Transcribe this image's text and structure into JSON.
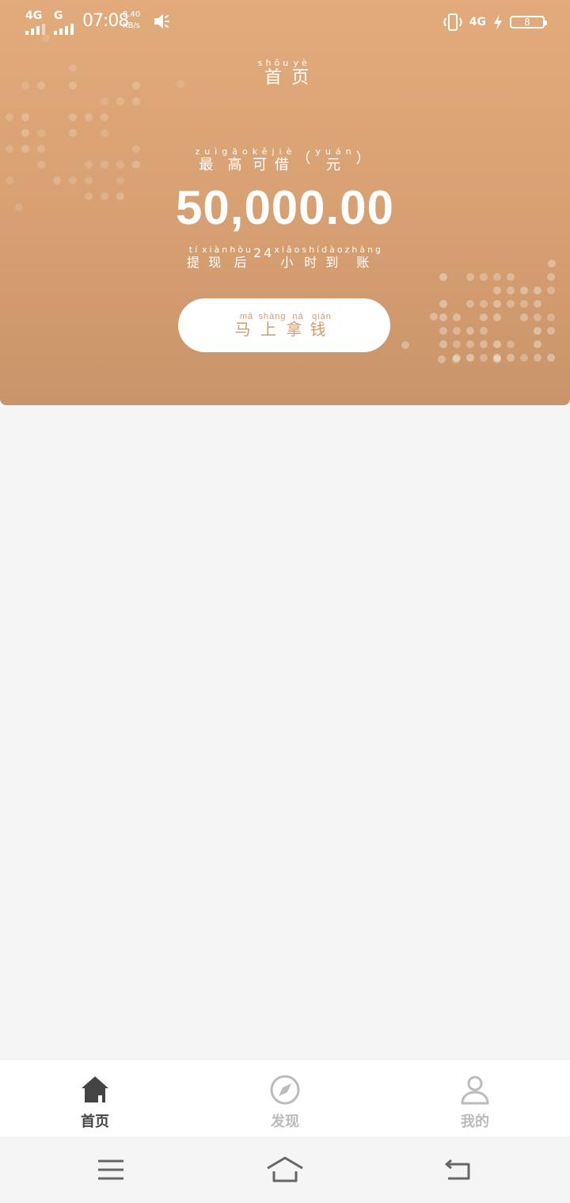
{
  "status_bar": {
    "network1": "4G",
    "network2": "G",
    "time": "07:08",
    "speed_value": "8.40",
    "speed_unit": "KB/s",
    "network3": "4G",
    "battery_level": "8"
  },
  "header": {
    "title": [
      {
        "char": "首",
        "pinyin": "shǒu"
      },
      {
        "char": "页",
        "pinyin": "yè"
      }
    ]
  },
  "loan": {
    "limit_label": [
      {
        "char": "最",
        "pinyin": "zuì"
      },
      {
        "char": "高",
        "pinyin": "gāo"
      },
      {
        "char": "可",
        "pinyin": "kě"
      },
      {
        "char": "借",
        "pinyin": "jiè"
      },
      {
        "char": "（",
        "pinyin": ""
      },
      {
        "char": "元",
        "pinyin": "yuán"
      },
      {
        "char": "）",
        "pinyin": ""
      }
    ],
    "amount": "50,000.00",
    "note": [
      {
        "char": "提",
        "pinyin": "tí"
      },
      {
        "char": "现",
        "pinyin": "xiàn"
      },
      {
        "char": "后",
        "pinyin": "hòu"
      },
      {
        "char": "24",
        "pinyin": ""
      },
      {
        "char": "小",
        "pinyin": "xiǎo"
      },
      {
        "char": "时",
        "pinyin": "shí"
      },
      {
        "char": "到",
        "pinyin": "dào"
      },
      {
        "char": "账",
        "pinyin": "zhàng"
      }
    ],
    "cta": [
      {
        "char": "马",
        "pinyin": "mǎ"
      },
      {
        "char": "上",
        "pinyin": "shàng"
      },
      {
        "char": "拿",
        "pinyin": "ná"
      },
      {
        "char": "钱",
        "pinyin": "qián"
      }
    ]
  },
  "tabs": [
    {
      "label": "首页",
      "icon": "home-icon",
      "active": true
    },
    {
      "label": "发现",
      "icon": "compass-icon",
      "active": false
    },
    {
      "label": "我的",
      "icon": "user-icon",
      "active": false
    }
  ],
  "colors": {
    "accent": "#d7a072",
    "tab_active": "#444444",
    "tab_inactive": "#bbbbbb"
  }
}
